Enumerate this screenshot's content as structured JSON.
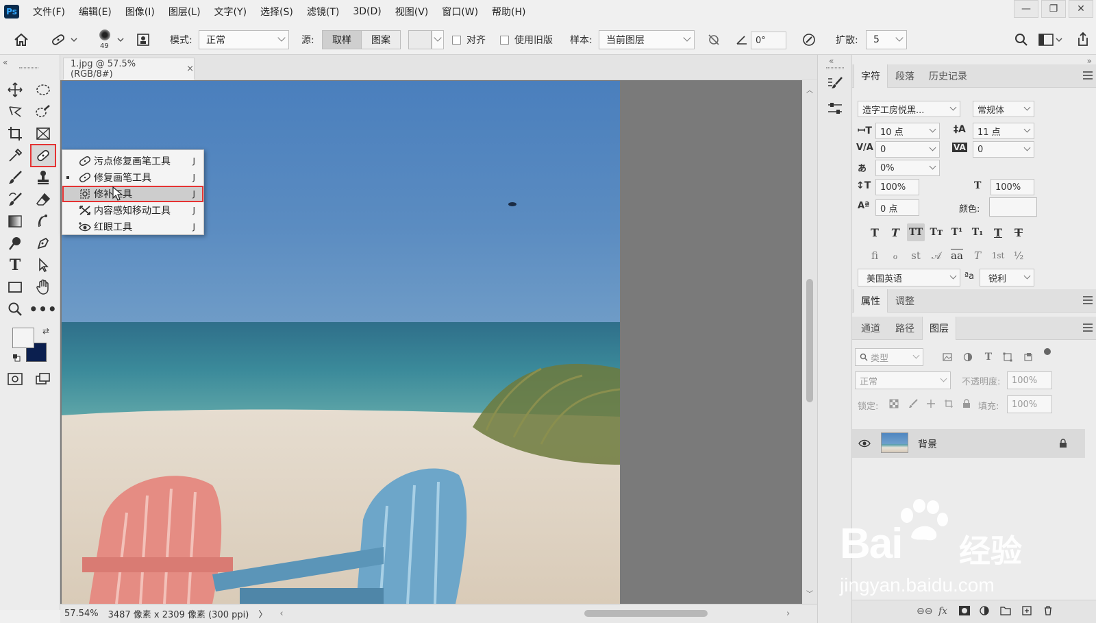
{
  "app": {
    "logo": "Ps"
  },
  "menu": [
    "文件(F)",
    "编辑(E)",
    "图像(I)",
    "图层(L)",
    "文字(Y)",
    "选择(S)",
    "滤镜(T)",
    "3D(D)",
    "视图(V)",
    "窗口(W)",
    "帮助(H)"
  ],
  "window_controls": {
    "minimize": "—",
    "restore": "❐",
    "close": "✕"
  },
  "options": {
    "brush_size": "49",
    "mode_label": "模式:",
    "mode_value": "正常",
    "source_label": "源:",
    "source_sample": "取样",
    "source_pattern": "图案",
    "align_label": "对齐",
    "legacy_label": "使用旧版",
    "sample_label": "样本:",
    "sample_value": "当前图层",
    "angle_value": "0°",
    "diffusion_label": "扩散:",
    "diffusion_value": "5"
  },
  "document": {
    "tab_title": "1.jpg @ 57.5%(RGB/8#)",
    "tab_close": "×",
    "zoom": "57.54%",
    "doc_info": "3487 像素 x 2309 像素 (300 ppi)",
    "status_arrow": "〉",
    "scroll_left": "‹",
    "scroll_right": "›"
  },
  "flyout": {
    "items": [
      {
        "label": "污点修复画笔工具",
        "shortcut": "J",
        "icon": "spot-healing-icon"
      },
      {
        "label": "修复画笔工具",
        "shortcut": "J",
        "icon": "healing-brush-icon"
      },
      {
        "label": "修补工具",
        "shortcut": "J",
        "icon": "patch-icon"
      },
      {
        "label": "内容感知移动工具",
        "shortcut": "J",
        "icon": "content-aware-move-icon"
      },
      {
        "label": "红眼工具",
        "shortcut": "J",
        "icon": "red-eye-icon"
      }
    ]
  },
  "character_panel": {
    "tabs": [
      "字符",
      "段落",
      "历史记录"
    ],
    "font_family": "造字工房悦黑...",
    "font_style": "常规体",
    "font_size": "10 点",
    "leading": "11 点",
    "kerning": "0",
    "tracking": "0",
    "scale_pct": "0%",
    "vertical_scale": "100%",
    "horizontal_scale": "100%",
    "baseline_shift": "0 点",
    "color_label": "颜色:",
    "type_buttons": [
      "T",
      "T",
      "TT",
      "Tт",
      "T¹",
      "T₁",
      "T",
      "T"
    ],
    "opentype_buttons": [
      "fi",
      "ℴ",
      "st",
      "𝒜",
      "aa",
      "T",
      "1st",
      "½"
    ],
    "language": "美国英语",
    "aa_label": "ªa",
    "antialias": "锐利"
  },
  "properties_panel": {
    "tabs": [
      "属性",
      "调整"
    ]
  },
  "layers_panel": {
    "tabs": [
      "通道",
      "路径",
      "图层"
    ],
    "filter_placeholder": "类型",
    "blend_mode": "正常",
    "opacity_label": "不透明度:",
    "opacity_value": "100%",
    "lock_label": "锁定:",
    "fill_label": "填充:",
    "fill_value": "100%",
    "layers": [
      {
        "name": "背景",
        "visible": true,
        "locked": true
      }
    ]
  },
  "watermark": {
    "brand": "Bai",
    "brand2": "经验",
    "url": "jingyan.baidu.com"
  },
  "colors": {
    "accent_red": "#e53333",
    "background_swatch": "#0b1f4f",
    "foreground_swatch": "#f4f4f4"
  }
}
